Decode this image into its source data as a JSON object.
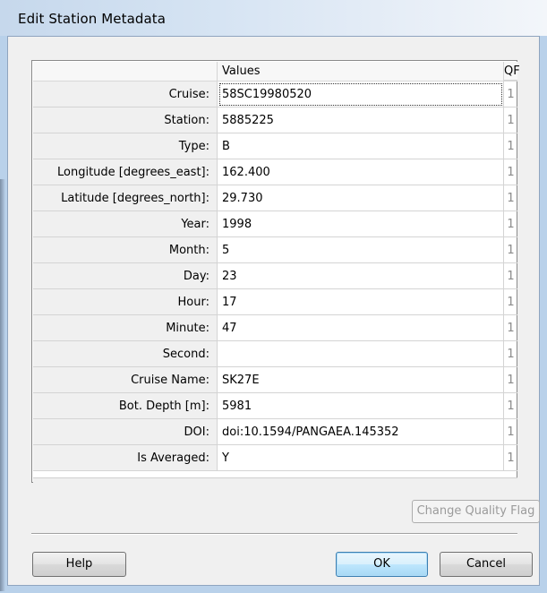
{
  "window": {
    "title": "Edit Station Metadata"
  },
  "table": {
    "headers": {
      "label": "",
      "values": "Values",
      "qf": "QF"
    },
    "rows": [
      {
        "label": "Cruise:",
        "value": "58SC19980520",
        "qf": "1"
      },
      {
        "label": "Station:",
        "value": "5885225",
        "qf": "1"
      },
      {
        "label": "Type:",
        "value": "B",
        "qf": "1"
      },
      {
        "label": "Longitude [degrees_east]:",
        "value": "162.400",
        "qf": "1"
      },
      {
        "label": "Latitude [degrees_north]:",
        "value": "29.730",
        "qf": "1"
      },
      {
        "label": "Year:",
        "value": "1998",
        "qf": "1"
      },
      {
        "label": "Month:",
        "value": "5",
        "qf": "1"
      },
      {
        "label": "Day:",
        "value": "23",
        "qf": "1"
      },
      {
        "label": "Hour:",
        "value": "17",
        "qf": "1"
      },
      {
        "label": "Minute:",
        "value": "47",
        "qf": "1"
      },
      {
        "label": "Second:",
        "value": "",
        "qf": "1"
      },
      {
        "label": "Cruise Name:",
        "value": "SK27E",
        "qf": "1"
      },
      {
        "label": "Bot. Depth [m]:",
        "value": "5981",
        "qf": "1"
      },
      {
        "label": "DOI:",
        "value": "doi:10.1594/PANGAEA.145352",
        "qf": "1"
      },
      {
        "label": "Is Averaged:",
        "value": "Y",
        "qf": "1"
      }
    ]
  },
  "buttons": {
    "change_quality_flag": "Change Quality Flag",
    "help": "Help",
    "ok": "OK",
    "cancel": "Cancel"
  }
}
